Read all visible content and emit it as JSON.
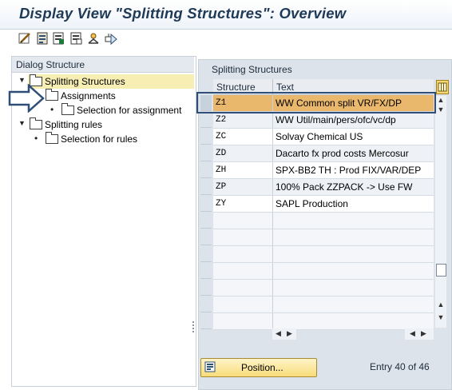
{
  "window": {
    "title": "Display View \"Splitting Structures\": Overview"
  },
  "toolbar": {
    "icons": [
      "change-display-icon",
      "details-icon",
      "select-all-icon",
      "deselect-all-icon",
      "print-icon",
      "other-entries-icon"
    ]
  },
  "dialog_structure": {
    "header": "Dialog Structure",
    "items": [
      {
        "label": "Splitting Structures",
        "level": 0,
        "expanded": true,
        "selected": true
      },
      {
        "label": "Assignments",
        "level": 1,
        "expanded": false,
        "selected": false
      },
      {
        "label": "Selection for assignment",
        "level": 2,
        "expanded": false,
        "selected": false
      },
      {
        "label": "Splitting rules",
        "level": 1,
        "expanded": true,
        "selected": false
      },
      {
        "label": "Selection for rules",
        "level": 2,
        "expanded": false,
        "selected": false
      }
    ]
  },
  "table": {
    "title": "Splitting Structures",
    "columns": [
      "Structure",
      "Text"
    ],
    "rows": [
      {
        "structure": "Z1",
        "text": "WW Common split VR/FX/DP",
        "highlighted": true
      },
      {
        "structure": "Z2",
        "text": "WW Util/main/pers/ofc/vc/dp",
        "highlighted": false
      },
      {
        "structure": "ZC",
        "text": "Solvay Chemical US",
        "highlighted": false
      },
      {
        "structure": "ZD",
        "text": "Dacarto fx prod costs Mercosur",
        "highlighted": false
      },
      {
        "structure": "ZH",
        "text": "SPX-BB2 TH : Prod FIX/VAR/DEP",
        "highlighted": false
      },
      {
        "structure": "ZP",
        "text": "100% Pack ZZPACK -> Use FW",
        "highlighted": false
      },
      {
        "structure": "ZY",
        "text": "SAPL Production",
        "highlighted": false
      }
    ]
  },
  "footer": {
    "position_button": "Position...",
    "entry_info": "Entry 40 of 46"
  },
  "colors": {
    "title": "#1f3a56",
    "selected_tree_bg": "#f7eeb4",
    "highlight_row": "#eab86c",
    "callout_border": "#2f4e78"
  }
}
